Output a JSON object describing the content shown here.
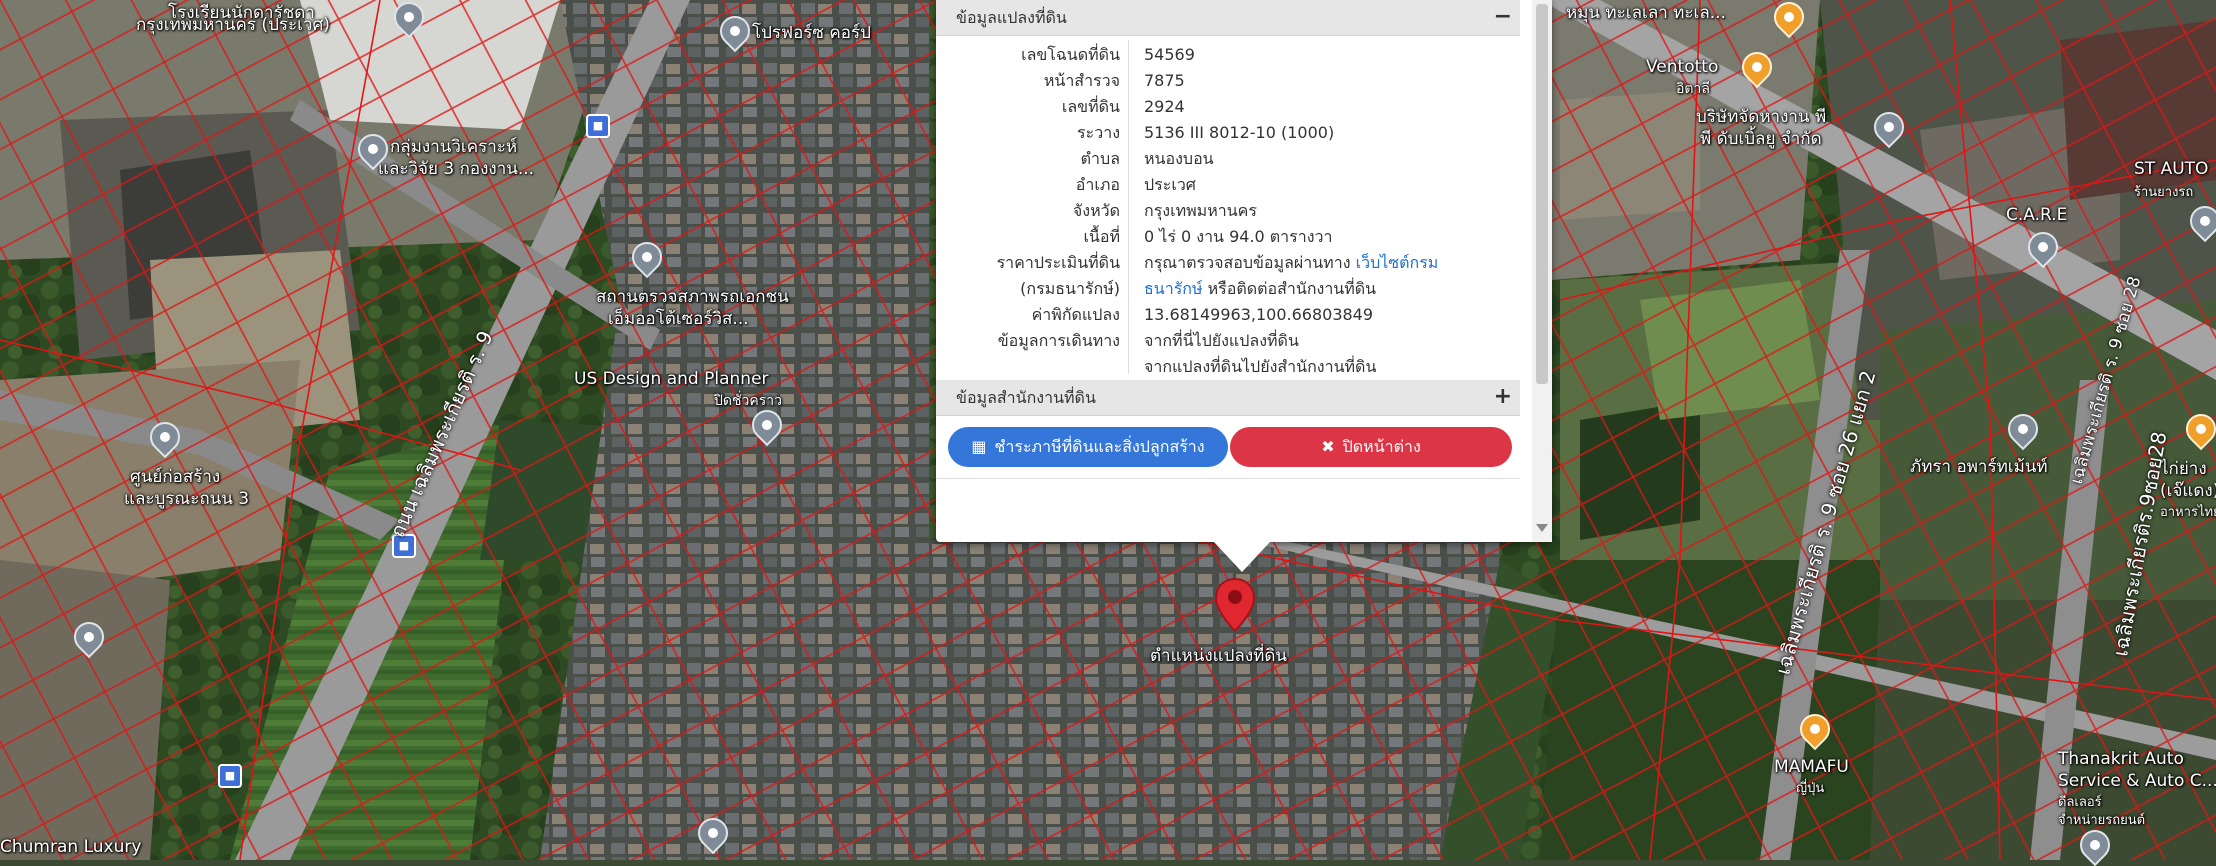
{
  "popup": {
    "section1_title": "ข้อมูลแปลงที่ดิน",
    "section1_toggle": "−",
    "rows": [
      {
        "key": "เลขโฉนดที่ดิน",
        "value": "54569"
      },
      {
        "key": "หน้าสำรวจ",
        "value": "7875"
      },
      {
        "key": "เลขที่ดิน",
        "value": "2924"
      },
      {
        "key": "ระวาง",
        "value": "5136 III 8012-10 (1000)"
      },
      {
        "key": "ตำบล",
        "value": "หนองบอน"
      },
      {
        "key": "อำเภอ",
        "value": "ประเวศ"
      },
      {
        "key": "จังหวัด",
        "value": "กรุงเทพมหานคร"
      },
      {
        "key": "เนื้อที่",
        "value": "0 ไร่ 0 งาน 94.0 ตารางวา"
      }
    ],
    "price_key1": "ราคาประเมินที่ดิน",
    "price_key2": "(กรมธนารักษ์)",
    "price_text1": "กรุณาตรวจสอบข้อมูลผ่านทาง ",
    "price_link1": "เว็บไซต์กรม",
    "price_link2": "ธนารักษ์",
    "price_text2": " หรือติดต่อสำนักงานที่ดิน",
    "coord_key": "ค่าพิกัดแปลง",
    "coord_value": "13.68149963,100.66803849",
    "travel_key": "ข้อมูลการเดินทาง",
    "travel_link1": "จากที่นี่ไปยังแปลงที่ดิน",
    "travel_link2": "จากแปลงที่ดินไปยังสำนักงานที่ดิน",
    "section2_title": "ข้อมูลสำนักงานที่ดิน",
    "section2_toggle": "+",
    "tax_button": "ชำระภาษีที่ดินและสิ่งปลูกสร้าง",
    "close_button": "ปิดหน้าต่าง"
  },
  "marker": {
    "label": "ตำแหน่งแปลงที่ดิน",
    "color": "#e0262e"
  },
  "map_labels": {
    "school1": "โรงเรียนนักดารัชดา",
    "school2": "กรุงเทพมหานคร (ประเวศ)",
    "proforz": "โปรฟอร์ซ คอร์ป",
    "group1": "กลุ่มงานวิเคราะห์",
    "group2": "และวิจัย 3 กองงาน...",
    "cert1": "สถานตรวจสภาพรถเอกชน",
    "cert2": "เอ็มออโต้เซอร์วิส...",
    "usdesign": "US Design and Planner",
    "closed": "ปิดชั่วคราว",
    "center1": "ศูนย์ก่อสร้าง",
    "center2": "และบูรณะถนน 3",
    "road_main": "ถนน เฉลิมพระเกียรติ ร. 9",
    "road_soi26": "เฉลิมพระเกียรติ ร. 9 ซอย 26 แยก 2",
    "road_soi28": "เฉลิมพระเกียรติ ร. 9 ซอย 28",
    "road_soi_right": "เฉลิมพระเกียรติร.9ซอย28",
    "hmun": "หมุน ทะเลเลา ทะเล...",
    "ventotto": "Ventotto",
    "ventotto_sub": "อิตาลี",
    "company1": "บริษัทจัดหางาน พี",
    "company2": "พี ดับเบิ้ลยู จำกัด",
    "stauto": "ST AUTO",
    "stauto_sub": "ร้านยางรถ",
    "care": "C.A.R.E",
    "pattra": "ภัทรา อพาร์ทเม้นท์",
    "kai": "ไก่ย่าง",
    "kai_sub": "(เจ๊แดง)",
    "kai_sub2": "อาหารไทย",
    "mamafu": "MAMAFU",
    "mamafu_sub": "ญี่ปุ่น",
    "thanakrit1": "Thanakrit Auto",
    "thanakrit2": "Service & Auto C...",
    "thanakrit3": "ดีลเลอร์",
    "thanakrit4": "จำหน่ายรถยนต์",
    "chumran": "Chumran Luxury"
  }
}
